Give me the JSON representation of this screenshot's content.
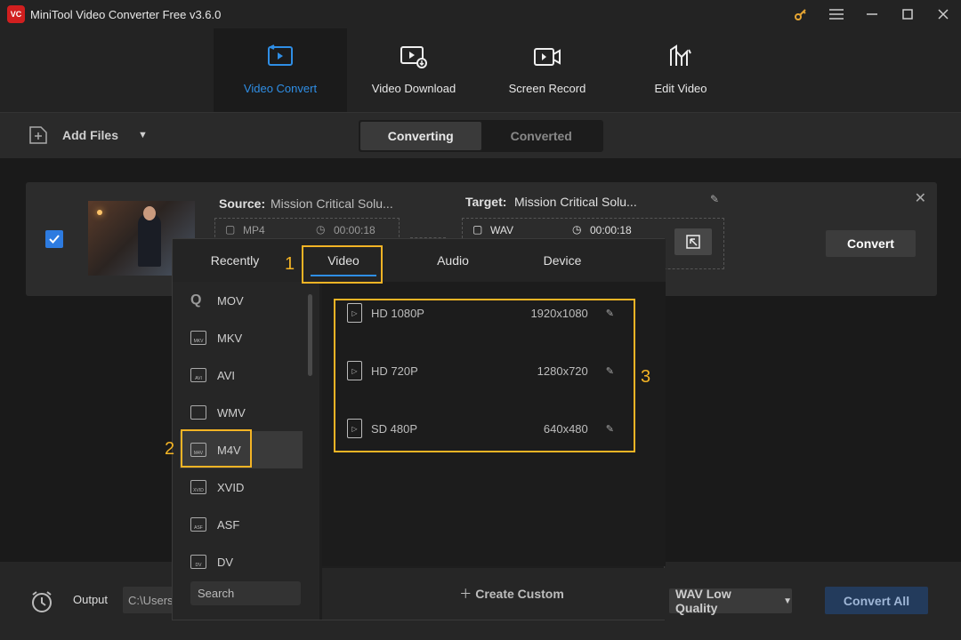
{
  "window": {
    "title": "MiniTool Video Converter Free v3.6.0",
    "logo_text": "VC"
  },
  "nav": [
    {
      "label": "Video Convert"
    },
    {
      "label": "Video Download"
    },
    {
      "label": "Screen Record"
    },
    {
      "label": "Edit Video"
    }
  ],
  "toolbar": {
    "add_files": "Add Files",
    "seg": [
      "Converting",
      "Converted"
    ]
  },
  "card": {
    "source_label": "Source:",
    "source_name": "Mission Critical Solu...",
    "source_format": "MP4",
    "source_duration": "00:00:18",
    "target_label": "Target:",
    "target_name": "Mission Critical Solu...",
    "target_format": "WAV",
    "target_duration": "00:00:18",
    "convert": "Convert"
  },
  "popup": {
    "tabs": [
      "Recently",
      "Video",
      "Audio",
      "Device"
    ],
    "formats": [
      "MOV",
      "MKV",
      "AVI",
      "WMV",
      "M4V",
      "XVID",
      "ASF",
      "DV"
    ],
    "search_placeholder": "Search",
    "presets": [
      {
        "name": "HD 1080P",
        "res": "1920x1080"
      },
      {
        "name": "HD 720P",
        "res": "1280x720"
      },
      {
        "name": "SD 480P",
        "res": "640x480"
      }
    ],
    "create_custom": "Create Custom"
  },
  "bottom": {
    "output_label": "Output",
    "output_path": "C:\\Users",
    "quality": "WAV Low Quality",
    "convert_all": "Convert All"
  },
  "annotations": [
    "1",
    "2",
    "3"
  ],
  "colors": {
    "accent": "#2f8ee5",
    "highlight": "#f4b425",
    "app_red": "#d11f1f"
  }
}
